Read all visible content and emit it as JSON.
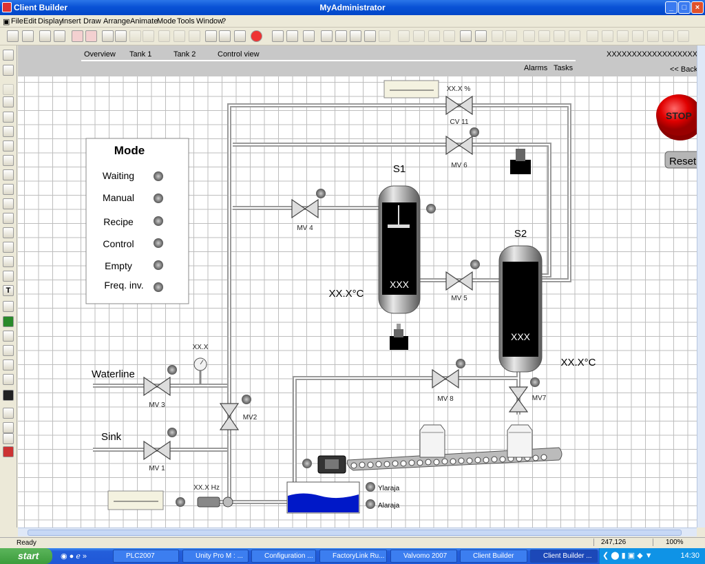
{
  "window": {
    "app_title": "Client Builder",
    "doc_title": "MyAdministrator",
    "min": "_",
    "max": "□",
    "close": "×"
  },
  "menu": [
    "File",
    "Edit",
    "Display",
    "Insert",
    "Draw",
    "Arrange",
    "Animate",
    "Mode",
    "Tools",
    "Window",
    "?"
  ],
  "header": {
    "nav": [
      "Overview",
      "Tank 1",
      "Tank 2",
      "Control view"
    ],
    "right_text": "XXXXXXXXXXXXXXXXXXXXXX",
    "alarms": "Alarms",
    "tasks": "Tasks",
    "back": "<< Back",
    "stop": "STOP",
    "reset": "Reset"
  },
  "mode": {
    "title": "Mode",
    "items": [
      "Waiting",
      "Manual",
      "Recipe",
      "Control",
      "Empty",
      "Freq. inv."
    ]
  },
  "process": {
    "s1": "S1",
    "s2": "S2",
    "xxx": "XXX",
    "temp1": "XX.X°C",
    "temp2": "XX.X°C",
    "cv11": "CV 11",
    "cv11_pct": "XX.X %",
    "mv6": "MV 6",
    "mv4": "MV 4",
    "mv5": "MV 5",
    "mv3": "MV 3",
    "mv1": "MV 1",
    "mv2": "MV2",
    "mv8": "MV 8",
    "mv7": "MV7",
    "waterline": "Waterline",
    "sink": "Sink",
    "pressure": "XX.X",
    "freq": "XX.X Hz",
    "ylaraja": "Ylaraja",
    "alaraja": "Alaraja"
  },
  "status": {
    "left": "Ready",
    "coords": "247,126",
    "zoom": "100%"
  },
  "taskbar": {
    "start": "start",
    "tasks": [
      "PLC2007",
      "Unity Pro M : ...",
      "Configuration ...",
      "FactoryLink Ru...",
      "Valvomo 2007",
      "Client Builder",
      "Client Builder ..."
    ],
    "clock": "14:30"
  },
  "colors": {
    "title_blue": "#0a53d6",
    "tank_gray": "#a8a8a8",
    "water": "#0018c8",
    "stop_red": "#e00000"
  }
}
